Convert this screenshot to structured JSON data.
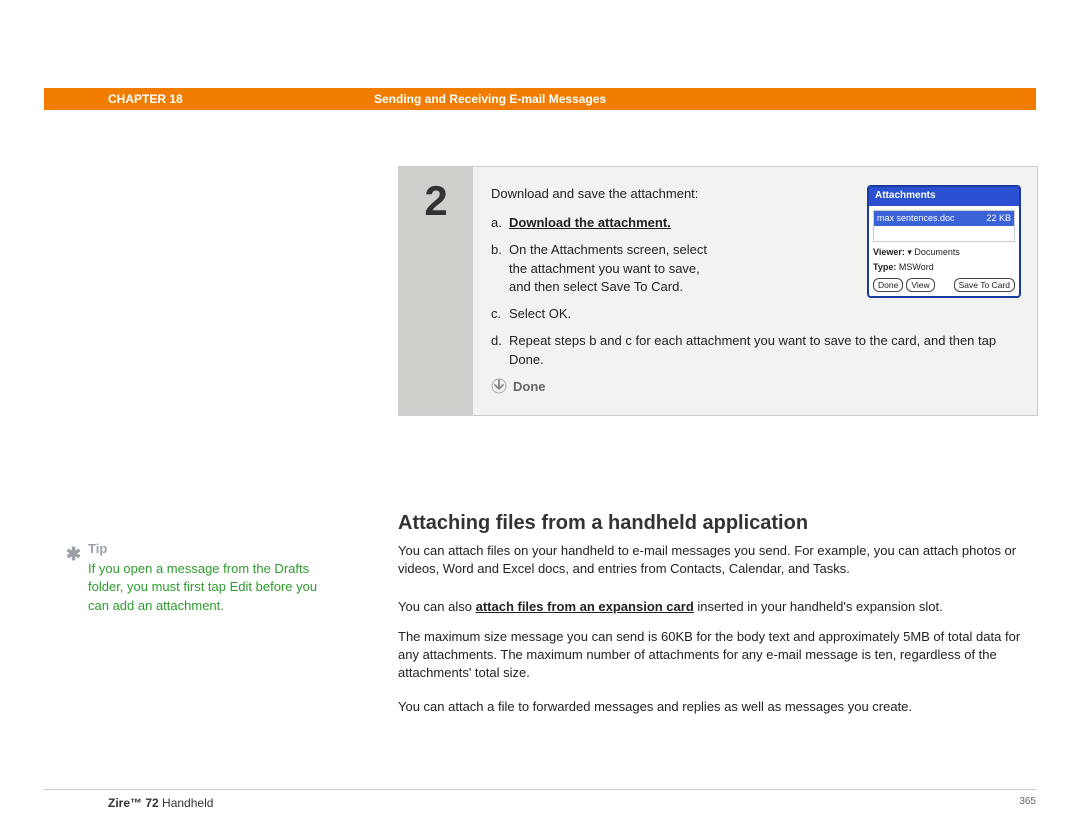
{
  "header": {
    "chapter": "CHAPTER 18",
    "section": "Sending and Receiving E-mail Messages"
  },
  "step": {
    "number": "2",
    "intro": "Download and save the attachment:",
    "items": [
      {
        "letter": "a.",
        "text": "Download the attachment.",
        "bold_underline": true,
        "narrow": true
      },
      {
        "letter": "b.",
        "text": "On the Attachments screen, select the attachment you want to save, and then select Save To Card.",
        "narrow": true
      },
      {
        "letter": "c.",
        "text": "Select OK."
      },
      {
        "letter": "d.",
        "text": "Repeat steps b and c for each attachment you want to save to the card, and then tap Done."
      }
    ],
    "done": "Done"
  },
  "palm": {
    "title": "Attachments",
    "file_name": "max sentences.doc",
    "file_size": "22 KB",
    "viewer_label": "Viewer:",
    "viewer_value": "Documents",
    "type_label": "Type:",
    "type_value": "MSWord",
    "buttons": {
      "done": "Done",
      "view": "View",
      "save": "Save To Card"
    }
  },
  "section_heading": "Attaching files from a handheld application",
  "paragraphs": {
    "p1": "You can attach files on your handheld to e-mail messages you send. For example, you can attach photos or videos, Word and Excel docs, and entries from Contacts, Calendar, and Tasks.",
    "p2_pre": "You can also ",
    "p2_link": "attach files from an expansion card",
    "p2_post": " inserted in your handheld's expansion slot.",
    "p3": "The maximum size message you can send is 60KB for the body text and approximately 5MB of total data for any attachments. The maximum number of attachments for any e-mail message is ten, regardless of the attachments' total size.",
    "p4": "You can attach a file to forwarded messages and replies as well as messages you create."
  },
  "tip": {
    "label": "Tip",
    "text": "If you open a message from the Drafts folder, you must first tap Edit before you can add an attachment."
  },
  "footer": {
    "product_bold": "Zire™ 72",
    "product_rest": " Handheld",
    "page": "365"
  }
}
